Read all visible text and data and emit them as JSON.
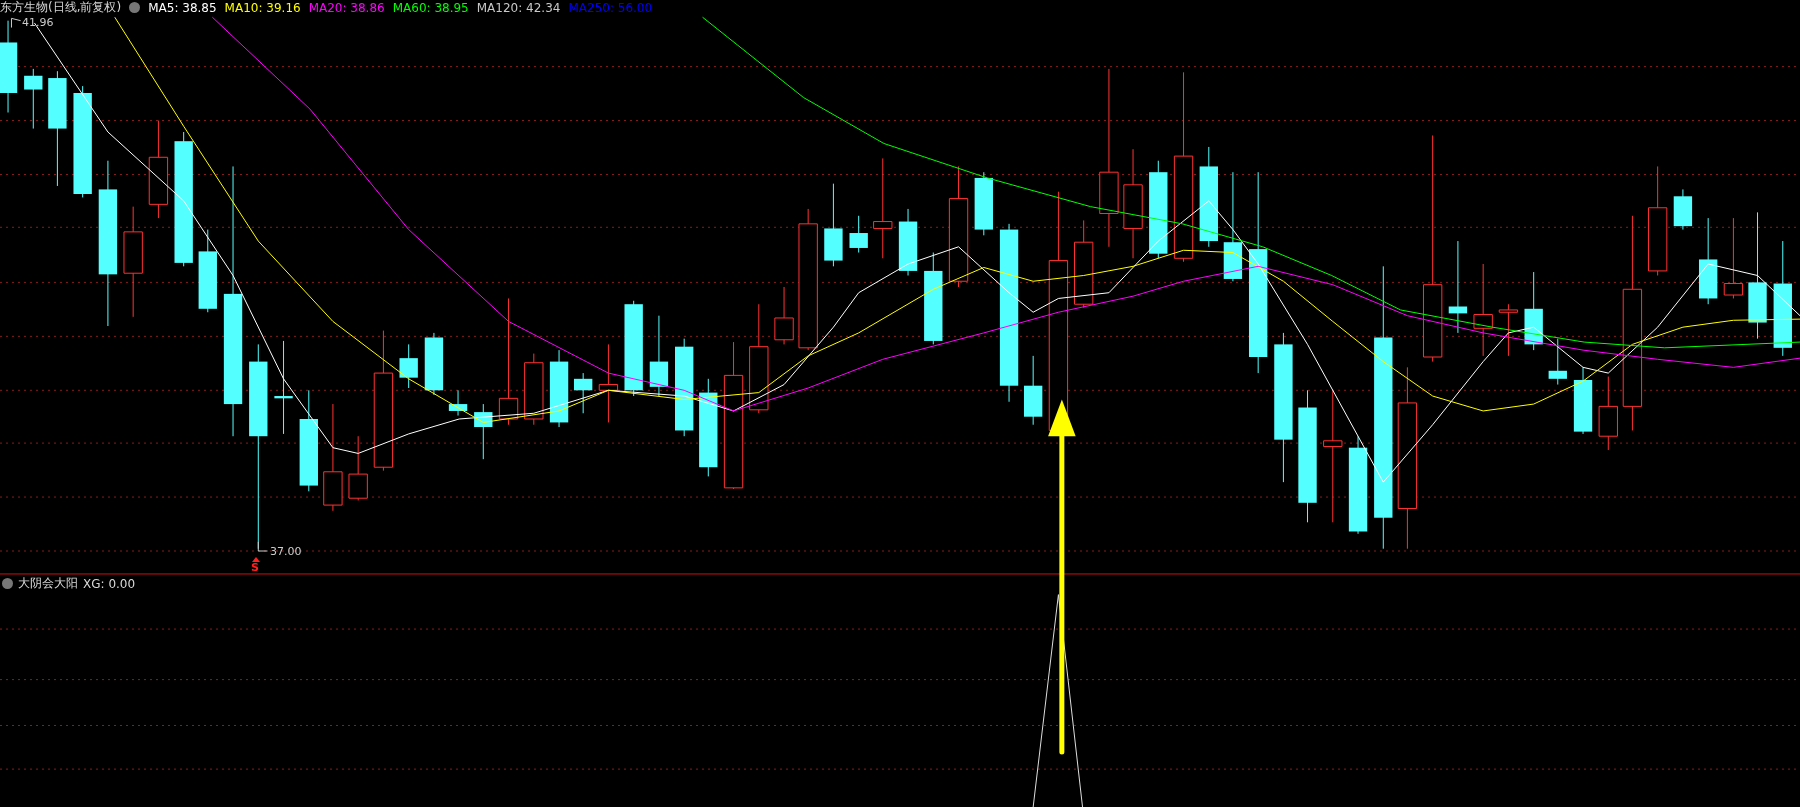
{
  "chart_header": {
    "title": "东方生物(日线,前复权)",
    "moving_averages": [
      {
        "label": "MA5: 38.85",
        "color": "#ffffff"
      },
      {
        "label": "MA10: 39.16",
        "color": "#ffff00"
      },
      {
        "label": "MA20: 38.86",
        "color": "#ff00ff"
      },
      {
        "label": "MA60: 38.95",
        "color": "#00ff00"
      },
      {
        "label": "MA120: 42.34",
        "color": "#c8c8c8"
      },
      {
        "label": "MA250: 56.00",
        "color": "#0000ff"
      }
    ]
  },
  "price_labels": [
    {
      "kind": "high",
      "text": "41.96"
    },
    {
      "kind": "low",
      "text": "37.00"
    }
  ],
  "signal_marker": "S",
  "indicator_panel": {
    "title": "大阴会大阳",
    "reading": "XG: 0.00"
  }
}
